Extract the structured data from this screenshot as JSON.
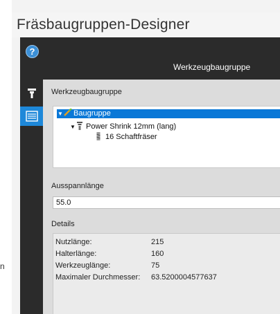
{
  "window": {
    "title": "Fräsbaugruppen-Designer"
  },
  "header": {
    "help_icon": "question-circle-icon",
    "title": "Werkzeugbaugruppe"
  },
  "rail": {
    "items": [
      {
        "icon": "tool-holder-icon"
      },
      {
        "icon": "list-sheet-icon",
        "active": true
      }
    ]
  },
  "assembly_panel": {
    "label": "Werkzeugbaugruppe",
    "tree": [
      {
        "label": "Baugruppe",
        "icon": "pencil-assembly-icon",
        "selected": true,
        "expanded": true
      },
      {
        "label": "Power Shrink 12mm (lang)",
        "icon": "holder-icon",
        "expanded": true
      },
      {
        "label": "16 Schaftfräser",
        "icon": "end-mill-icon"
      }
    ]
  },
  "clamping": {
    "label": "Ausspannlänge",
    "value": "55.0"
  },
  "details": {
    "label": "Details",
    "rows": [
      {
        "label": "Nutzlänge:",
        "value": "215"
      },
      {
        "label": "Halterlänge:",
        "value": "160"
      },
      {
        "label": "Werkzeuglänge:",
        "value": "75"
      },
      {
        "label": "Maximaler Durchmesser:",
        "value": "63.5200004577637"
      }
    ]
  },
  "stray_text": "n",
  "colors": {
    "accent": "#0a78d7",
    "dark": "#2b2b2b",
    "rail_active": "#1e88d9"
  }
}
